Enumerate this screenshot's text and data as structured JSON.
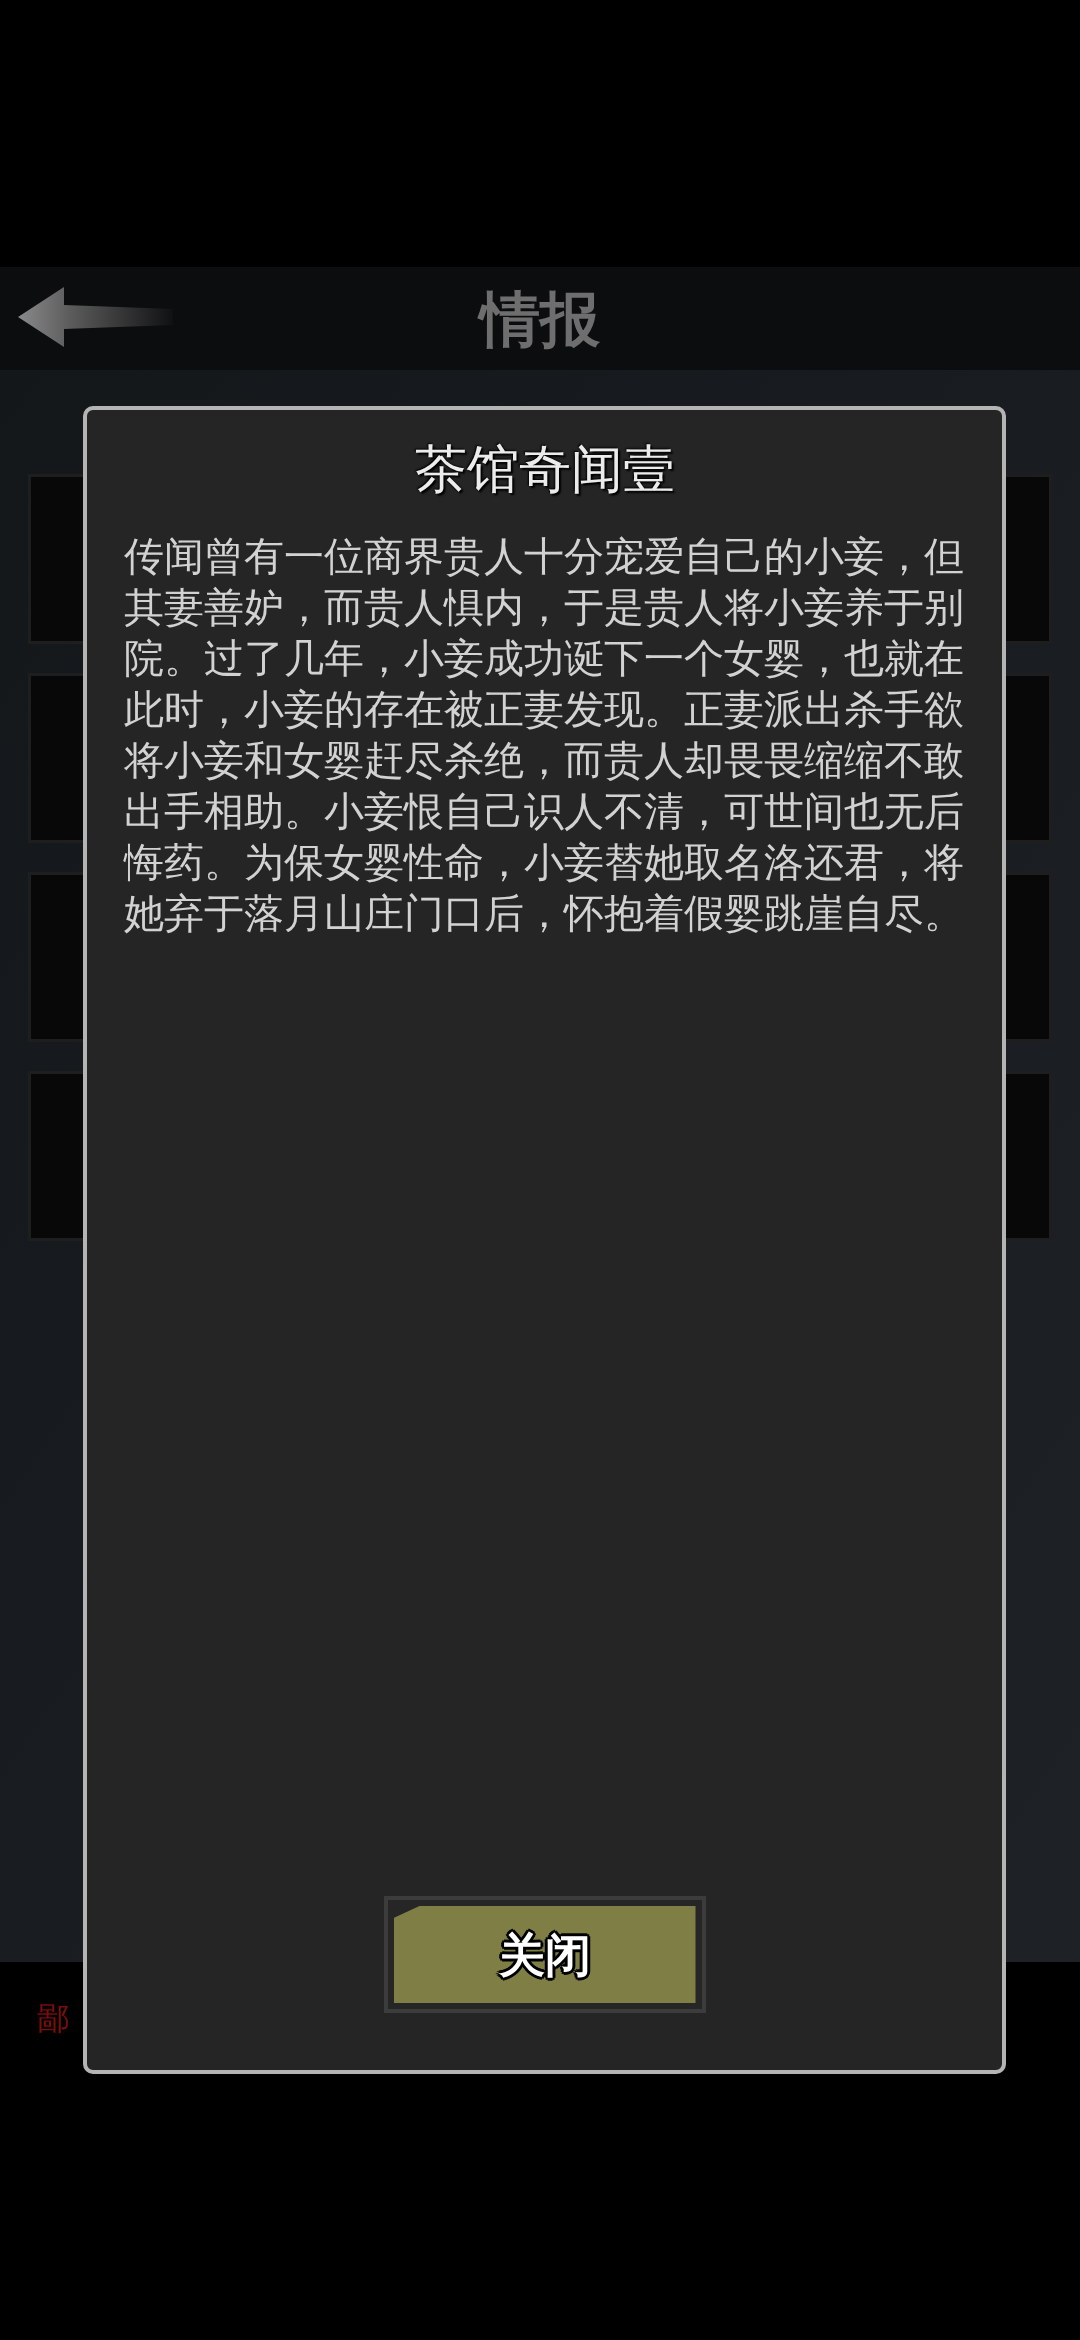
{
  "header": {
    "title": "情报"
  },
  "partial_label": "鄙",
  "dialog": {
    "title": "茶馆奇闻壹",
    "body": "传闻曾有一位商界贵人十分宠爱自己的小妾，但其妻善妒，而贵人惧内，于是贵人将小妾养于别院。过了几年，小妾成功诞下一个女婴，也就在此时，小妾的存在被正妻发现。正妻派出杀手欲将小妾和女婴赶尽杀绝，而贵人却畏畏缩缩不敢出手相助。小妾恨自己识人不清，可世间也无后悔药。为保女婴性命，小妾替她取名洛还君，将她弃于落月山庄门口后，怀抱着假婴跳崖自尽。",
    "buttons": [
      {
        "label": "关闭"
      }
    ]
  }
}
